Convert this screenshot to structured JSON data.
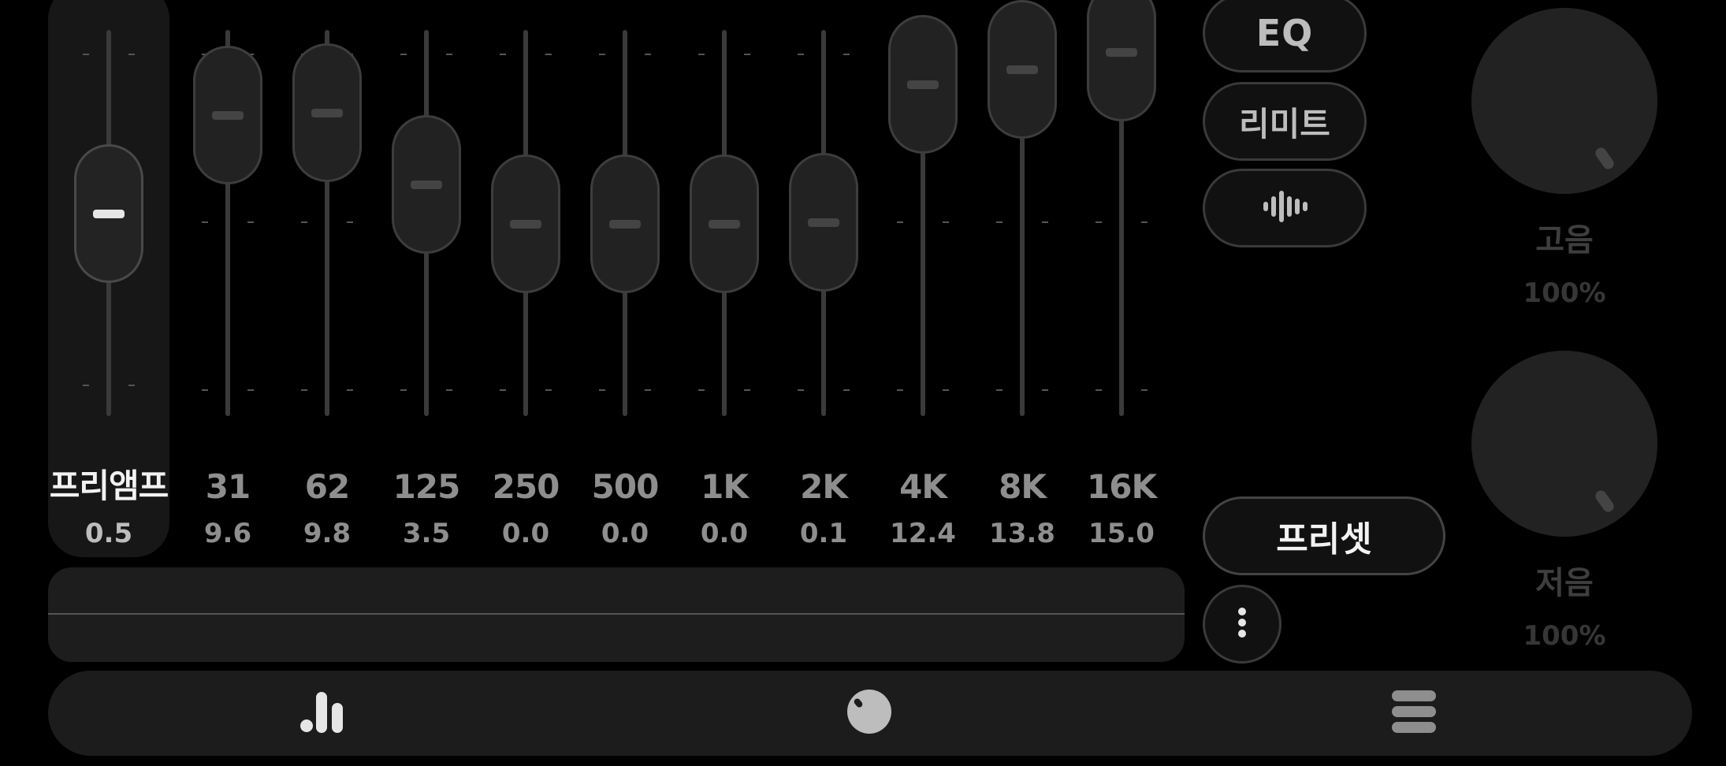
{
  "preamp": {
    "label": "프리앰프",
    "value": "0.5"
  },
  "bands": [
    {
      "freq": "31",
      "gain": "9.6"
    },
    {
      "freq": "62",
      "gain": "9.8"
    },
    {
      "freq": "125",
      "gain": "3.5"
    },
    {
      "freq": "250",
      "gain": "0.0"
    },
    {
      "freq": "500",
      "gain": "0.0"
    },
    {
      "freq": "1K",
      "gain": "0.0"
    },
    {
      "freq": "2K",
      "gain": "0.1"
    },
    {
      "freq": "4K",
      "gain": "12.4"
    },
    {
      "freq": "8K",
      "gain": "13.8"
    },
    {
      "freq": "16K",
      "gain": "15.0"
    }
  ],
  "buttons": {
    "eq": "EQ",
    "limit": "리미트",
    "visualizer_icon": "waveform-icon",
    "presets": "프리셋",
    "more_icon": "vertical-dots-icon"
  },
  "knobs": {
    "treble": {
      "label": "고음",
      "value": "100%"
    },
    "bass": {
      "label": "저음",
      "value": "100%"
    }
  },
  "nav": {
    "items": [
      {
        "icon": "equalizer-bars-icon"
      },
      {
        "icon": "knob-icon"
      },
      {
        "icon": "stack-menu-icon"
      }
    ]
  },
  "colors": {
    "background": "#000000",
    "panel": "#1c1c1c",
    "accent": "#e6e6e6"
  }
}
